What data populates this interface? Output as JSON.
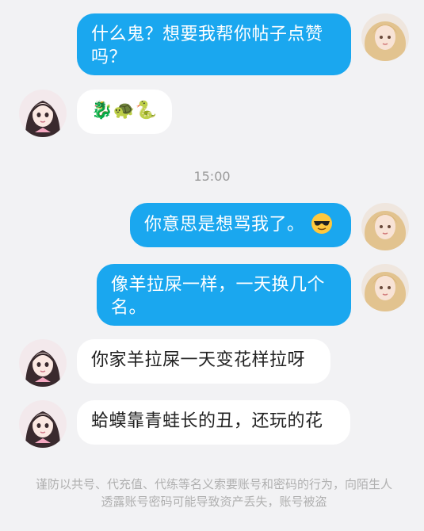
{
  "messages": [
    {
      "side": "right",
      "text": "什么鬼？想要我帮你帖子点赞吗？",
      "avatar": "blonde-girl-avatar"
    },
    {
      "side": "left",
      "text": "🐉🐢🐍",
      "avatar": "dark-hair-girl-avatar"
    },
    {
      "side": "right",
      "text": "你意思是想骂我了。",
      "emoji": "sunglasses-face",
      "avatar": "blonde-girl-avatar"
    },
    {
      "side": "right",
      "text": "像羊拉屎一样，一天换几个名。",
      "avatar": "blonde-girl-avatar"
    },
    {
      "side": "left",
      "text": "你家羊拉屎一天变花样拉呀",
      "avatar": "dark-hair-girl-avatar"
    },
    {
      "side": "left",
      "text": "蛤蟆靠青蛙长的丑，还玩的花",
      "avatar": "dark-hair-girl-avatar"
    }
  ],
  "timestamp": "15:00",
  "warning": "谨防以共号、代充值、代练等名义索要账号和密码的行为，向陌生人透露账号密码可能导致资产丢失，账号被盗",
  "colors": {
    "background": "#f2f2f4",
    "outgoing_bubble": "#1aa7ef",
    "incoming_bubble": "#ffffff"
  }
}
